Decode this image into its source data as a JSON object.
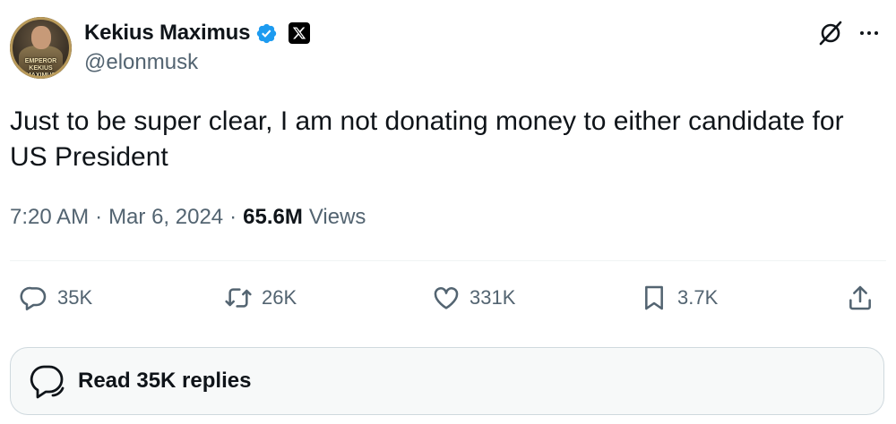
{
  "author": {
    "display_name": "Kekius Maximus",
    "handle": "@elonmusk",
    "avatar_banner_text": "EMPEROR KEKIUS MAXIMUS",
    "verified_color": "#1d9bf0"
  },
  "tweet": {
    "text": "Just to be super clear, I am not donating money to either candidate for US President",
    "time": "7:20 AM",
    "date": "Mar 6, 2024",
    "views_count": "65.6M",
    "views_label": "Views",
    "separator": "·"
  },
  "actions": {
    "replies": "35K",
    "reposts": "26K",
    "likes": "331K",
    "bookmarks": "3.7K"
  },
  "read_replies": {
    "label": "Read 35K replies"
  },
  "icons": [
    "verified-badge-icon",
    "x-logo-icon",
    "grok-icon",
    "more-icon",
    "reply-icon",
    "repost-icon",
    "like-icon",
    "bookmark-icon",
    "share-icon",
    "chat-bubble-icon"
  ],
  "colors": {
    "text": "#0f1419",
    "secondary_text": "#536471",
    "divider": "#eff3f4",
    "button_border": "#cfd9de"
  }
}
